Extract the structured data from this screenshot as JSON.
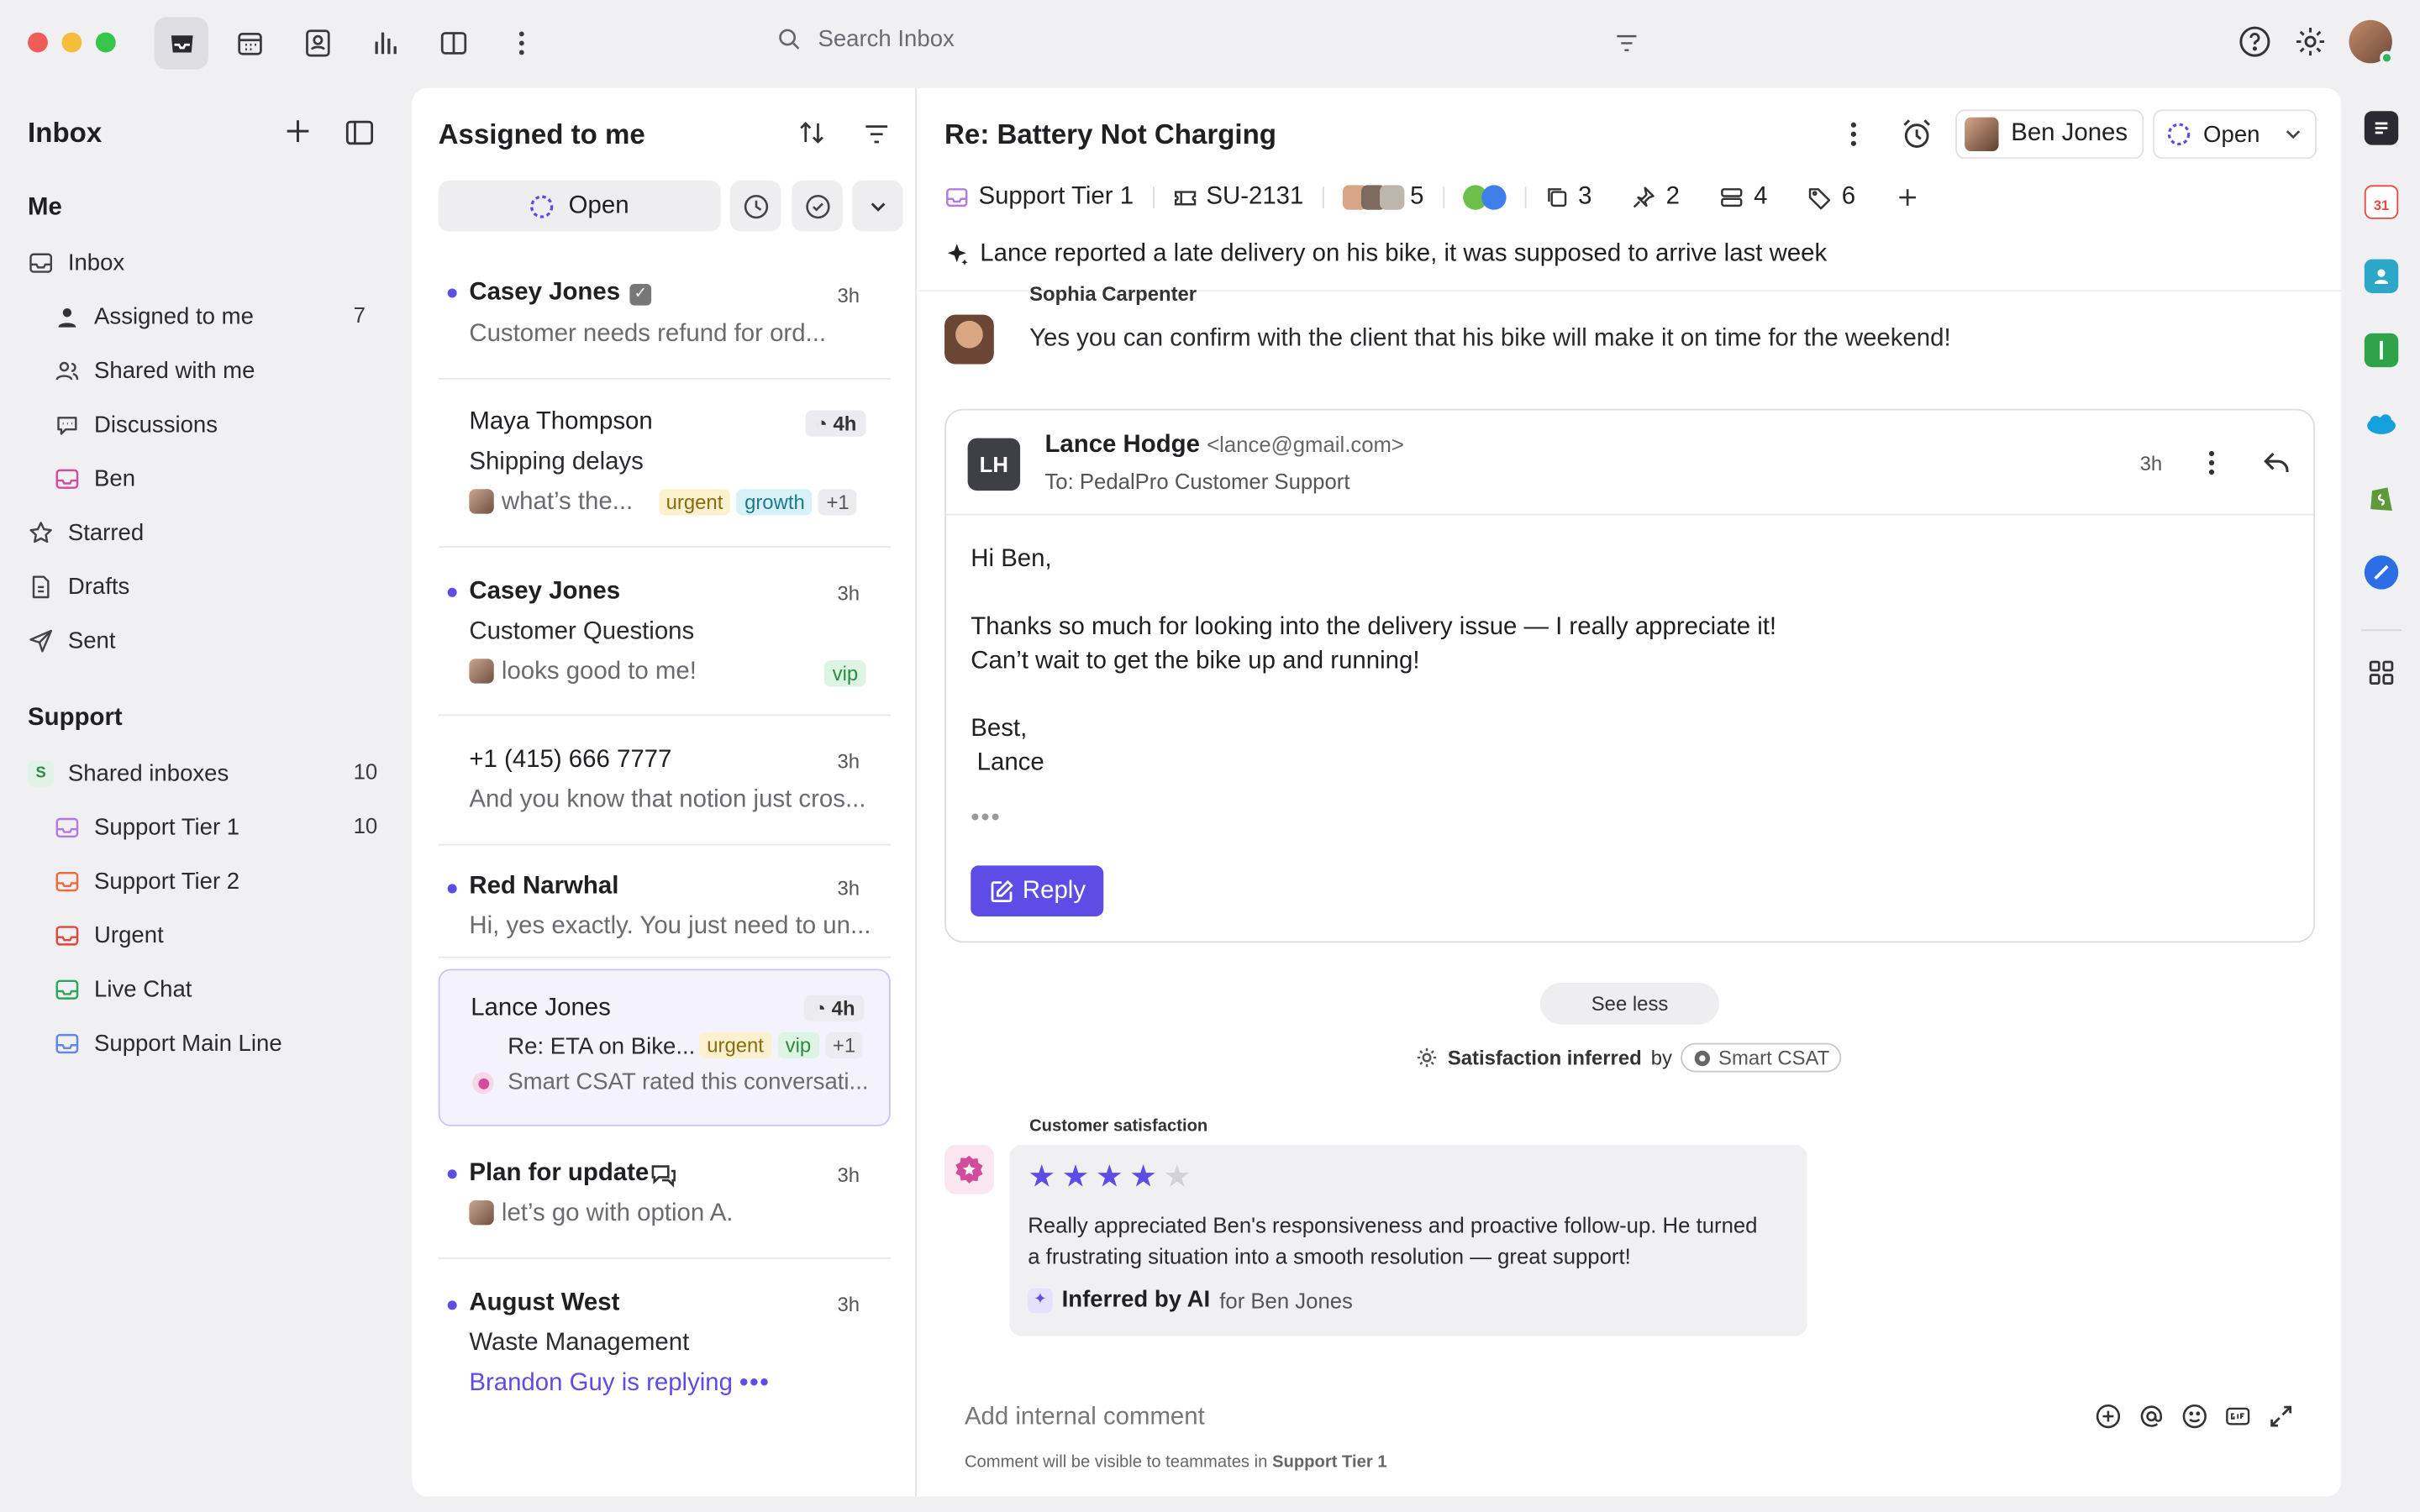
{
  "topbar": {
    "search_placeholder": "Search Inbox",
    "icons": [
      "inbox-icon",
      "calendar-icon",
      "contacts-icon",
      "analytics-icon",
      "split-view-icon",
      "more-icon"
    ]
  },
  "sidebar": {
    "title": "Inbox",
    "me_section": "Me",
    "items": [
      {
        "label": "Inbox"
      },
      {
        "label": "Assigned to me",
        "count": "7"
      },
      {
        "label": "Shared with me"
      },
      {
        "label": "Discussions"
      },
      {
        "label": "Ben"
      },
      {
        "label": "Starred"
      },
      {
        "label": "Drafts"
      },
      {
        "label": "Sent"
      }
    ],
    "support_section": "Support",
    "support_items": [
      {
        "label": "Shared inboxes",
        "count": "10",
        "badge": "S"
      },
      {
        "label": "Support Tier 1",
        "count": "10"
      },
      {
        "label": "Support Tier 2"
      },
      {
        "label": "Urgent"
      },
      {
        "label": "Live Chat"
      },
      {
        "label": "Support Main Line"
      }
    ]
  },
  "list": {
    "title": "Assigned to me",
    "status": "Open",
    "conversations": [
      {
        "name": "Casey Jones",
        "time": "3h",
        "line1": "Customer needs refund for ord..."
      },
      {
        "name": "Maya Thompson",
        "time": "4h",
        "line1": "Shipping delays",
        "line2": "what’s the...",
        "tags": [
          "urgent",
          "growth",
          "+1"
        ]
      },
      {
        "name": "Casey Jones",
        "time": "3h",
        "line1": "Customer Questions",
        "line2": "looks good to me!",
        "tags": [
          "vip"
        ]
      },
      {
        "name": "+1 (415) 666 7777",
        "time": "3h",
        "line1": "And you know that notion just cros..."
      },
      {
        "name": "Red Narwhal",
        "time": "3h",
        "line1": "Hi, yes exactly. You just need to un..."
      },
      {
        "name": "Lance Jones",
        "time": "4h",
        "line1": "Re: ETA on Bike...",
        "line2": "Smart CSAT rated this conversati...",
        "tags": [
          "urgent",
          "vip",
          "+1"
        ]
      },
      {
        "name": "Plan for update",
        "time": "3h",
        "line1": "let’s go with option A."
      },
      {
        "name": "August West",
        "time": "3h",
        "line1": "Waste Management",
        "line2": "Brandon Guy is replying"
      }
    ]
  },
  "pane": {
    "title": "Re: Battery Not Charging",
    "assignee": "Ben Jones",
    "status": "Open",
    "meta": {
      "inbox": "Support Tier 1",
      "ticket": "SU-2131",
      "participants": "5",
      "threads": "3",
      "pins": "2",
      "links": "4",
      "tags": "6"
    },
    "summary": "Lance reported a late delivery on his bike, it was supposed to arrive last week",
    "prev_sender": "Sophia Carpenter",
    "prev_message": "Yes you can confirm with the client that his bike will make it on time for the weekend!",
    "email": {
      "initials": "LH",
      "from_name": "Lance Hodge",
      "from_addr": "<lance@gmail.com>",
      "to": "To: PedalPro Customer Support",
      "time": "3h",
      "greeting": "Hi Ben,",
      "body1": "Thanks so much for looking into the delivery issue — I really appreciate it!",
      "body2": "Can’t wait to get the bike up and running!",
      "signoff": "Best,",
      "signature": "Lance",
      "reply_label": "Reply"
    },
    "see_less": "See less",
    "sat_inferred": "Satisfaction inferred",
    "by": "by",
    "smart_csat": "Smart CSAT",
    "cs_label": "Customer satisfaction",
    "rating": 4,
    "rating_max": 5,
    "cs_text": "Really appreciated Ben's responsiveness and proactive follow-up. He turned a frustrating situation into a smooth resolution — great support!",
    "inferred_label": "Inferred by AI",
    "inferred_for": "for Ben Jones",
    "comment_placeholder": "Add internal comment",
    "comment_note_prefix": "Comment will be visible to teammates in",
    "comment_note_inbox": "Support Tier 1"
  },
  "colors": {
    "accent": "#5d4de6",
    "star": "#5d4de6",
    "star_empty": "#d2d2d8"
  }
}
